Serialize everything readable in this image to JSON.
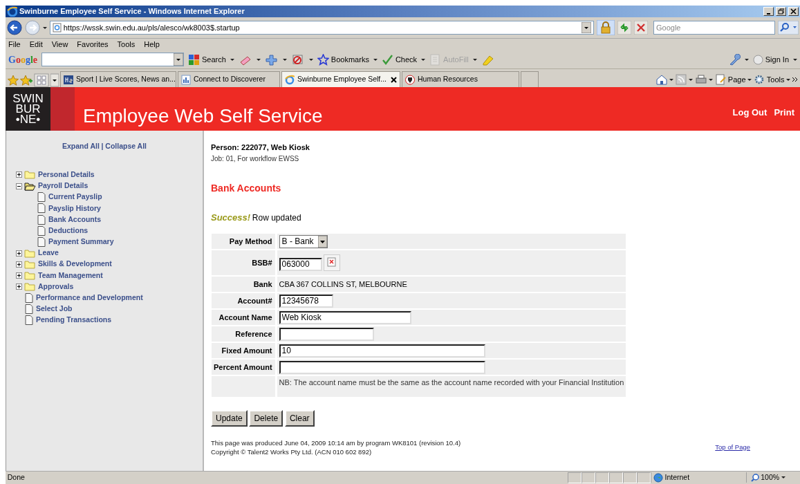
{
  "window": {
    "title": "Swinburne Employee Self Service - Windows Internet Explorer"
  },
  "address_bar": {
    "url": "https://wssk.swin.edu.au/pls/alesco/wk8003$.startup",
    "search_placeholder": "Google"
  },
  "menu": [
    "File",
    "Edit",
    "View",
    "Favorites",
    "Tools",
    "Help"
  ],
  "google_toolbar": {
    "logo": "Google",
    "items": [
      {
        "label": "Search",
        "disabled": false
      },
      {
        "label": "Bookmarks",
        "disabled": false
      },
      {
        "label": "Check",
        "disabled": false
      },
      {
        "label": "AutoFill",
        "disabled": true
      }
    ],
    "sign_in": "Sign In"
  },
  "tabs": [
    {
      "kind": "page",
      "label": "Sport | Live Scores, News an...",
      "selected": false
    },
    {
      "kind": "page",
      "label": "Connect to Discoverer",
      "selected": false
    },
    {
      "kind": "page",
      "label": "Swinburne Employee Self...",
      "selected": true
    },
    {
      "kind": "page",
      "label": "Human Resources",
      "selected": false
    },
    {
      "kind": "new",
      "selected": false
    }
  ],
  "command_bar": [
    "Page",
    "Tools"
  ],
  "header": {
    "logo": [
      "SWIN",
      "BUR",
      "•NE•"
    ],
    "title": "Employee Web Self Service",
    "links": [
      "Log Out",
      "Print"
    ]
  },
  "sidebar": {
    "links": [
      "Expand All",
      "Collapse All"
    ],
    "separator": "|",
    "tree": [
      {
        "kind": "folder",
        "label": "Personal Details",
        "expanded": false
      },
      {
        "kind": "folder",
        "label": "Payroll Details",
        "expanded": true,
        "children": [
          {
            "kind": "page",
            "label": "Current Payslip"
          },
          {
            "kind": "page",
            "label": "Payslip History"
          },
          {
            "kind": "page",
            "label": "Bank Accounts"
          },
          {
            "kind": "page",
            "label": "Deductions"
          },
          {
            "kind": "page",
            "label": "Payment Summary"
          }
        ]
      },
      {
        "kind": "folder",
        "label": "Leave",
        "expanded": false
      },
      {
        "kind": "folder",
        "label": "Skills & Development",
        "expanded": false
      },
      {
        "kind": "folder",
        "label": "Team Management",
        "expanded": false
      },
      {
        "kind": "folder",
        "label": "Approvals",
        "expanded": false
      },
      {
        "kind": "page",
        "label": "Performance and Development"
      },
      {
        "kind": "page",
        "label": "Select Job"
      },
      {
        "kind": "page",
        "label": "Pending Transactions"
      }
    ]
  },
  "person": {
    "name": "Person: 222077, Web Kiosk",
    "job": "Job: 01, For workflow EWSS"
  },
  "heading": "Bank Accounts",
  "message": {
    "status": "Success!",
    "text": "Row updated"
  },
  "form": {
    "rows": [
      {
        "label": "Pay Method",
        "kind": "select",
        "value": "B - Bank"
      },
      {
        "label": "BSB#",
        "kind": "input",
        "value": "063000",
        "lookup": true
      },
      {
        "label": "Bank",
        "kind": "text",
        "value": "CBA 367 COLLINS ST, MELBOURNE"
      },
      {
        "label": "Account#",
        "kind": "input",
        "value": "12345678"
      },
      {
        "label": "Account Name",
        "kind": "input",
        "value": "Web Kiosk"
      },
      {
        "label": "Reference",
        "kind": "input"
      },
      {
        "label": "Fixed Amount",
        "kind": "input",
        "value": "10"
      },
      {
        "label": "Percent Amount",
        "kind": "input"
      }
    ],
    "note": "NB: The account name must be the same as the account name recorded with your Financial Institution"
  },
  "buttons": [
    "Update",
    "Delete",
    "Clear"
  ],
  "footer": {
    "lines": [
      "This page was produced June 04, 2009 10:14 am by program WK8101 (revision 10.4)",
      "Copyright © Talent2 Works Pty Ltd. (ACN 010 602 892)"
    ],
    "top_link": "Top of Page"
  },
  "status_bar": {
    "text": "Done",
    "zone": "Internet",
    "zoom": "100%"
  }
}
